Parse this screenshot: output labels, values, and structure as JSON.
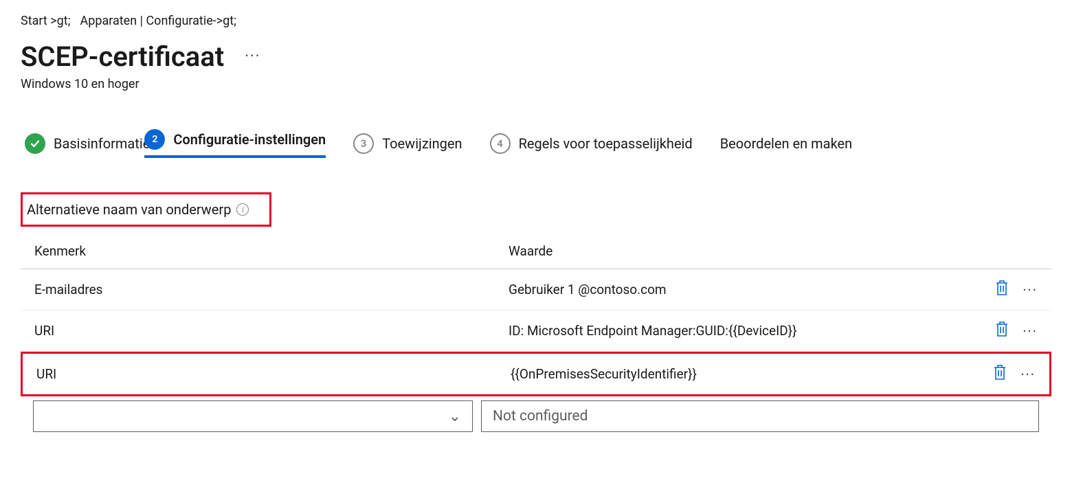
{
  "breadcrumb": {
    "item1": "Start >gt;",
    "item2": "Apparaten | Configuratie->gt;"
  },
  "header": {
    "title": "SCEP-certificaat",
    "subtitle": "Windows 10 en hoger"
  },
  "wizard": {
    "step1": "Basisinformatie",
    "step2": "Configuratie-instellingen",
    "step3_num": "3",
    "step3": "Toewijzingen",
    "step4_num": "4",
    "step4": "Regels voor toepasselijkheid",
    "step5": "Beoordelen en maken"
  },
  "section": {
    "title": "Alternatieve naam van onderwerp"
  },
  "table": {
    "header_attr": "Kenmerk",
    "header_val": "Waarde",
    "rows": [
      {
        "attr": "E-mailadres",
        "val": "Gebruiker 1 @contoso.com",
        "hl": false
      },
      {
        "attr": "URI",
        "val": "ID: Microsoft Endpoint Manager:GUID:{{DeviceID}}",
        "hl": false
      },
      {
        "attr": "URI",
        "val": "{{OnPremisesSecurityIdentifier}}",
        "hl": true
      }
    ]
  },
  "newrow": {
    "placeholder": "Not configured"
  }
}
